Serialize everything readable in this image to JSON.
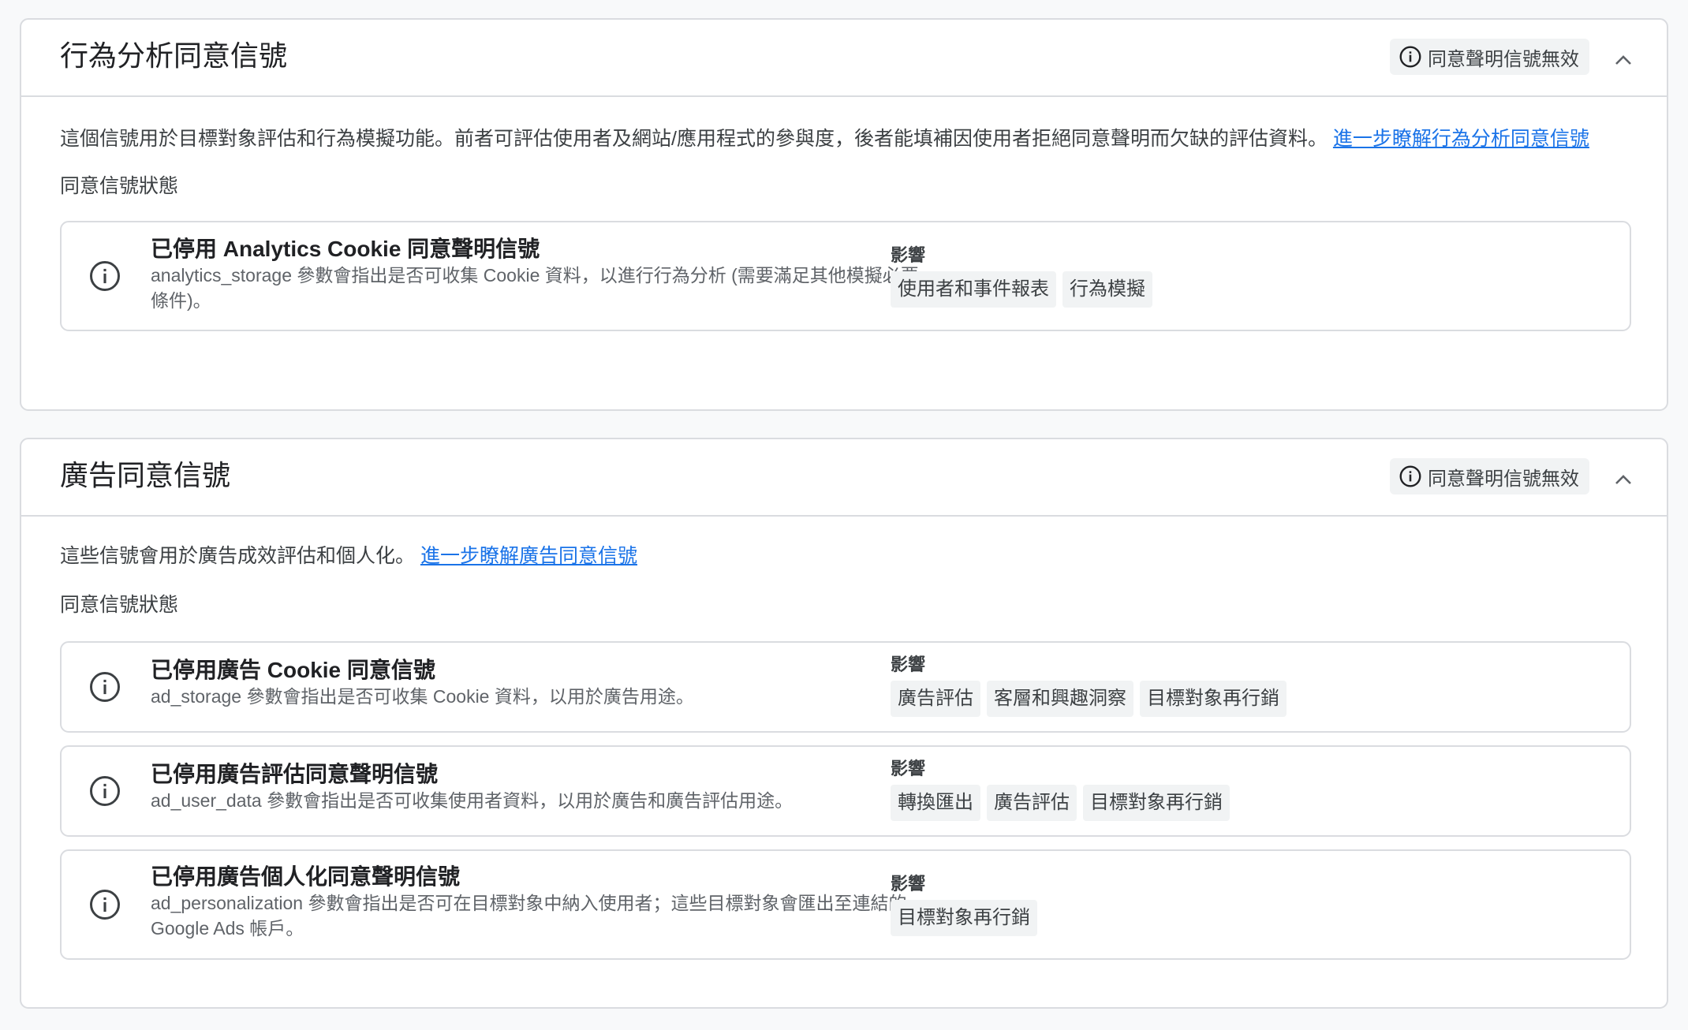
{
  "colors": {
    "link": "#1a73e8",
    "border": "#dadce0",
    "chip_bg": "#f1f3f4",
    "text_primary": "#202124",
    "text_secondary": "#5f6368"
  },
  "sections": [
    {
      "title": "行為分析同意信號",
      "status_chip": {
        "icon": "info-icon",
        "label": "同意聲明信號無效"
      },
      "collapse_icon": "chevron-up-icon",
      "description": "這個信號用於目標對象評估和行為模擬功能。前者可評估使用者及網站/應用程式的參與度，後者能填補因使用者拒絕同意聲明而欠缺的評估資料。 ",
      "learn_more_link": "進一步瞭解行為分析同意信號",
      "status_label": "同意信號狀態",
      "signals": [
        {
          "icon": "info-icon",
          "title": "已停用 Analytics Cookie 同意聲明信號",
          "subtitle": "analytics_storage 參數會指出是否可收集 Cookie 資料，以進行行為分析 (需要滿足其他模擬必要條件)。",
          "impact_label": "影響",
          "tags": [
            "使用者和事件報表",
            "行為模擬"
          ]
        }
      ]
    },
    {
      "title": "廣告同意信號",
      "status_chip": {
        "icon": "info-icon",
        "label": "同意聲明信號無效"
      },
      "collapse_icon": "chevron-up-icon",
      "description": "這些信號會用於廣告成效評估和個人化。 ",
      "learn_more_link": "進一步瞭解廣告同意信號",
      "status_label": "同意信號狀態",
      "signals": [
        {
          "icon": "info-icon",
          "title": "已停用廣告 Cookie 同意信號",
          "subtitle": "ad_storage 參數會指出是否可收集 Cookie 資料，以用於廣告用途。",
          "impact_label": "影響",
          "tags": [
            "廣告評估",
            "客層和興趣洞察",
            "目標對象再行銷"
          ]
        },
        {
          "icon": "info-icon",
          "title": "已停用廣告評估同意聲明信號",
          "subtitle": "ad_user_data 參數會指出是否可收集使用者資料，以用於廣告和廣告評估用途。",
          "impact_label": "影響",
          "tags": [
            "轉換匯出",
            "廣告評估",
            "目標對象再行銷"
          ]
        },
        {
          "icon": "info-icon",
          "title": "已停用廣告個人化同意聲明信號",
          "subtitle": "ad_personalization 參數會指出是否可在目標對象中納入使用者；這些目標對象會匯出至連結的 Google Ads 帳戶。",
          "impact_label": "影響",
          "tags": [
            "目標對象再行銷"
          ]
        }
      ]
    }
  ]
}
